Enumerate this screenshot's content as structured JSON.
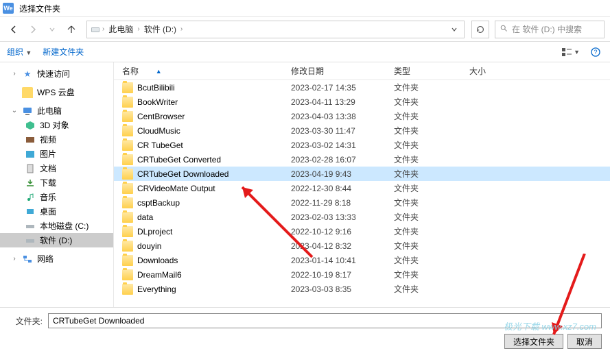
{
  "dialog": {
    "title": "选择文件夹"
  },
  "breadcrumb": {
    "pc": "此电脑",
    "drive": "软件 (D:)"
  },
  "search": {
    "placeholder": "在 软件 (D:) 中搜索"
  },
  "orgbar": {
    "organize": "组织",
    "new_folder": "新建文件夹"
  },
  "sidebar": {
    "quick_access": "快速访问",
    "wps_cloud": "WPS 云盘",
    "this_pc": "此电脑",
    "obj3d": "3D 对象",
    "videos": "视频",
    "pictures": "图片",
    "documents": "文档",
    "downloads": "下载",
    "music": "音乐",
    "desktop": "桌面",
    "local_c": "本地磁盘 (C:)",
    "software_d": "软件 (D:)",
    "network": "网络"
  },
  "cols": {
    "name": "名称",
    "date": "修改日期",
    "type": "类型",
    "size": "大小"
  },
  "type_folder": "文件夹",
  "rows": [
    {
      "name": "BcutBilibili",
      "date": "2023-02-17 14:35"
    },
    {
      "name": "BookWriter",
      "date": "2023-04-11 13:29"
    },
    {
      "name": "CentBrowser",
      "date": "2023-04-03 13:38"
    },
    {
      "name": "CloudMusic",
      "date": "2023-03-30 11:47"
    },
    {
      "name": "CR TubeGet",
      "date": "2023-03-02 14:31"
    },
    {
      "name": "CRTubeGet Converted",
      "date": "2023-02-28 16:07"
    },
    {
      "name": "CRTubeGet Downloaded",
      "date": "2023-04-19 9:43"
    },
    {
      "name": "CRVideoMate Output",
      "date": "2022-12-30 8:44"
    },
    {
      "name": "csptBackup",
      "date": "2022-11-29 8:18"
    },
    {
      "name": "data",
      "date": "2023-02-03 13:33"
    },
    {
      "name": "DLproject",
      "date": "2022-10-12 9:16"
    },
    {
      "name": "douyin",
      "date": "2023-04-12 8:32"
    },
    {
      "name": "Downloads",
      "date": "2023-01-14 10:41"
    },
    {
      "name": "DreamMail6",
      "date": "2022-10-19 8:17"
    },
    {
      "name": "Everything",
      "date": "2023-03-03 8:35"
    }
  ],
  "footer": {
    "label": "文件夹:",
    "value": "CRTubeGet Downloaded",
    "select_btn": "选择文件夹",
    "cancel_btn": "取消"
  },
  "watermark": "极光下载 www.xz7.com"
}
